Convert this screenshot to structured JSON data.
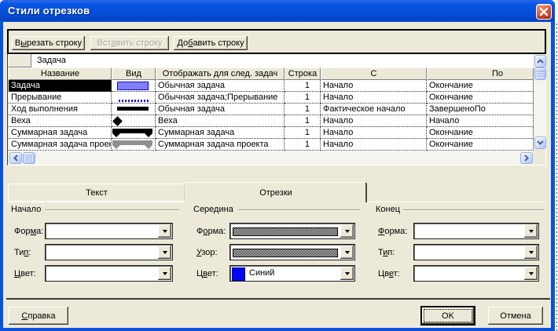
{
  "window": {
    "title": "Стили отрезков"
  },
  "toolbar": {
    "cut": {
      "text": "Вырезать строку",
      "m": 1
    },
    "paste": {
      "text": "Вставить строку",
      "m": 3
    },
    "add": {
      "text": "Добавить строку",
      "m": 2
    }
  },
  "entry": {
    "value": "Задача"
  },
  "table": {
    "columns": [
      "Название",
      "Вид",
      "Отображать для след. задач",
      "Строка",
      "С",
      "По"
    ],
    "rows": [
      {
        "name": "Задача",
        "bar": "blue",
        "show_for": "Обычная задача",
        "row": "1",
        "from": "Начало",
        "to": "Окончание",
        "selected": true
      },
      {
        "name": "Прерывание",
        "bar": "dots",
        "show_for": "Обычная задача;Прерывание",
        "row": "1",
        "from": "Начало",
        "to": "Окончание",
        "selected": false
      },
      {
        "name": "Ход выполнения",
        "bar": "thin",
        "show_for": "Обычная задача",
        "row": "1",
        "from": "Фактическое начало",
        "to": "ЗавершеноПо",
        "selected": false
      },
      {
        "name": "Веха",
        "bar": "diamond",
        "show_for": "Веха",
        "row": "1",
        "from": "Начало",
        "to": "Начало",
        "selected": false
      },
      {
        "name": "Суммарная задача",
        "bar": "summary",
        "show_for": "Суммарная задача",
        "row": "1",
        "from": "Начало",
        "to": "Окончание",
        "selected": false
      },
      {
        "name": "Суммарная задача проекта",
        "bar": "summary-gray",
        "show_for": "Суммарная задача проекта",
        "row": "1",
        "from": "Начало",
        "to": "Окончание",
        "selected": false
      }
    ]
  },
  "tabs": [
    {
      "label": "Текст",
      "active": false
    },
    {
      "label": "Отрезки",
      "active": true
    }
  ],
  "groups": {
    "start": {
      "label": "Начало",
      "fields": [
        {
          "label": "Форма:",
          "m": 3,
          "value": ""
        },
        {
          "label": "Тип:",
          "m": 2,
          "value": ""
        },
        {
          "label": "Цвет:",
          "m": 0,
          "value": ""
        }
      ]
    },
    "middle": {
      "label": "Середина",
      "fields": [
        {
          "label": "Форма:",
          "m": 1,
          "value": "hatched-bar"
        },
        {
          "label": "Узор:",
          "m": 0,
          "value": "hatched-pattern"
        },
        {
          "label": "Цвет:",
          "m": 1,
          "value": "Синий",
          "swatch": "#0005f0"
        }
      ]
    },
    "end": {
      "label": "Конец",
      "fields": [
        {
          "label": "Форма:",
          "m": 0,
          "value": ""
        },
        {
          "label": "Тип:",
          "m": 1,
          "value": ""
        },
        {
          "label": "Цвет:",
          "m": 2,
          "value": ""
        }
      ]
    }
  },
  "footer": {
    "help": {
      "text": "Справка",
      "m": 0
    },
    "ok": {
      "text": "OK"
    },
    "cancel": {
      "text": "Отмена"
    }
  },
  "colors": {
    "titlebar": "#0a55e2",
    "dialog_face": "#ece9d8",
    "selection": "#000000",
    "bar_blue": "#0000f0",
    "swatch_blue": "#0005f0"
  }
}
